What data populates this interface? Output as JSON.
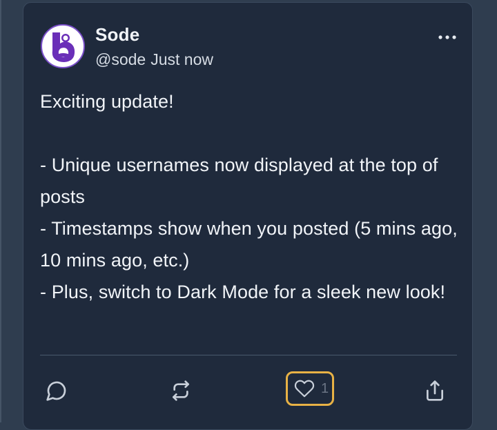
{
  "post": {
    "author": {
      "display_name": "Sode",
      "handle": "@sode",
      "avatar_icon": "sode-logo-icon",
      "avatar_color": "#6a2fb8"
    },
    "timestamp": "Just now",
    "body": "Exciting update!\n\n- Unique usernames now displayed at the top of posts\n- Timestamps show when you posted (5 mins ago, 10 mins ago, etc.)\n- Plus, switch to Dark Mode for a sleek new look!",
    "actions": {
      "comment_icon": "comment-icon",
      "repost_icon": "repost-icon",
      "like_icon": "heart-icon",
      "like_count": "1",
      "share_icon": "share-icon"
    },
    "more_icon": "more-dots-icon"
  },
  "theme": {
    "page_background": "#2f3d4f",
    "card_background": "#1f2a3c",
    "text_color": "#f1f4f8",
    "focus_ring": "#e8b245"
  }
}
